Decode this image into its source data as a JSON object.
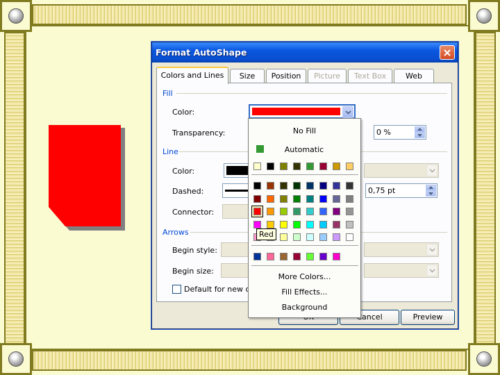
{
  "dialog": {
    "title": "Format AutoShape",
    "tabs": [
      {
        "label": "Colors and Lines",
        "state": "active"
      },
      {
        "label": "Size",
        "state": "enabled"
      },
      {
        "label": "Position",
        "state": "enabled"
      },
      {
        "label": "Picture",
        "state": "disabled"
      },
      {
        "label": "Text Box",
        "state": "disabled"
      },
      {
        "label": "Web",
        "state": "enabled"
      }
    ],
    "fill": {
      "group_label": "Fill",
      "color_label": "Color:",
      "color_value": "#ff0000",
      "transparency_label": "Transparency:",
      "transparency_value": "0 %"
    },
    "line": {
      "group_label": "Line",
      "color_label": "Color:",
      "color_value": "#000000",
      "dashed_label": "Dashed:",
      "connector_label": "Connector:",
      "weight_value": "0,75 pt"
    },
    "arrows": {
      "group_label": "Arrows",
      "begin_style_label": "Begin style:",
      "begin_size_label": "Begin size:"
    },
    "default_checkbox_label": "Default for new ob",
    "buttons": {
      "ok": "OK",
      "cancel": "Cancel",
      "preview": "Preview"
    }
  },
  "color_popup": {
    "no_fill": "No Fill",
    "automatic": "Automatic",
    "automatic_color": "#339933",
    "scheme_colors": [
      "#ffffcc",
      "#000000",
      "#808000",
      "#333300",
      "#339933",
      "#990033",
      "#cc9900",
      "#ffcc66"
    ],
    "standard_colors": [
      [
        "#000000",
        "#993300",
        "#333300",
        "#003300",
        "#003366",
        "#000080",
        "#333399",
        "#333333"
      ],
      [
        "#800000",
        "#ff6600",
        "#808000",
        "#008000",
        "#008080",
        "#0000ff",
        "#666699",
        "#808080"
      ],
      [
        "#ff0000",
        "#ff9900",
        "#99cc00",
        "#339966",
        "#33cccc",
        "#3366ff",
        "#800080",
        "#969696"
      ],
      [
        "#ff00ff",
        "#ffcc00",
        "#ffff00",
        "#00ff00",
        "#00ffff",
        "#00ccff",
        "#993366",
        "#c0c0c0"
      ],
      [
        "#ff99cc",
        "#ffcc99",
        "#ffff99",
        "#ccffcc",
        "#ccffff",
        "#99ccff",
        "#cc99ff",
        "#ffffff"
      ]
    ],
    "selected_color_name": "Red",
    "recent_colors": [
      "#003399",
      "#ff6699",
      "#996633",
      "#990033",
      "#66ff33",
      "#6600cc",
      "#ff00cc"
    ],
    "more_colors": "More Colors...",
    "fill_effects": "Fill Effects...",
    "background": "Background"
  },
  "shape": {
    "fill_color": "#ff0000",
    "shadow_color": "#808080"
  },
  "colors": {
    "title_bar": "#0a57e0",
    "frame": "#807a20",
    "page_bg": "#fbfbd2"
  }
}
